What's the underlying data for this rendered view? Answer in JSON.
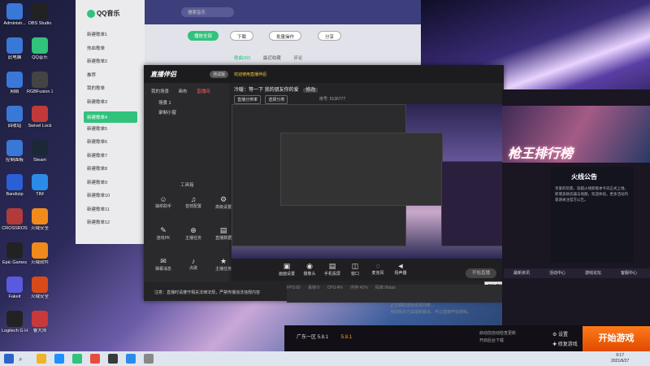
{
  "desktop": {
    "icons": [
      {
        "label": "Administr...",
        "color": "#3a78d8"
      },
      {
        "label": "OBS Studio",
        "color": "#222222"
      },
      {
        "label": "此电脑",
        "color": "#3a78d8"
      },
      {
        "label": "QQ音乐",
        "color": "#31c27c"
      },
      {
        "label": "网络",
        "color": "#3a78d8"
      },
      {
        "label": "RGBFusion 2.0",
        "color": "#444444"
      },
      {
        "label": "回收站",
        "color": "#3a78d8"
      },
      {
        "label": "Swivel Lock",
        "color": "#c03a3a"
      },
      {
        "label": "控制面板",
        "color": "#3a78d8"
      },
      {
        "label": "Steam",
        "color": "#1b2838"
      },
      {
        "label": "Bandizip",
        "color": "#2a5fd8"
      },
      {
        "label": "TIM",
        "color": "#2a8ce8"
      },
      {
        "label": "CROSSROS",
        "color": "#b23a3a"
      },
      {
        "label": "火绒安全",
        "color": "#f08a1a"
      },
      {
        "label": "Epic Games",
        "color": "#222222"
      },
      {
        "label": "火绒软件",
        "color": "#f08a1a"
      },
      {
        "label": "Fakeit",
        "color": "#5a5ae0"
      },
      {
        "label": "火绒安全",
        "color": "#d84a1a"
      },
      {
        "label": "Logitech G HUB",
        "color": "#222222"
      },
      {
        "label": "鲁大师",
        "color": "#c83a3a"
      }
    ]
  },
  "qq_music": {
    "app_name": "QQ音乐",
    "search_placeholder": "搜索音乐",
    "sidebar": [
      "新建歌单1",
      "热血歌单",
      "新建歌单2",
      "推荐",
      "我的歌单",
      "新建歌单3",
      "新建歌单4",
      "新建歌单5",
      "新建歌单6",
      "新建歌单7",
      "新建歌单8",
      "新建歌单9",
      "新建歌单10",
      "新建歌单11",
      "新建歌单12"
    ],
    "buttons": {
      "play_all": "播放全部",
      "download": "下载",
      "batch": "批量操作",
      "share": "分享"
    },
    "tabs": [
      "歌曲200",
      "最近收藏",
      "评论"
    ]
  },
  "live": {
    "app_name": "直播伴侣",
    "badge": "测试版",
    "notice": "欢迎使用直播伴侣",
    "tabs": [
      "我的场景",
      "画布",
      "直播间"
    ],
    "scenes": [
      "场景 1",
      "录制小窗"
    ],
    "tools_header": "工具箱",
    "tools": [
      {
        "icon": "☺",
        "label": "抽奖助手"
      },
      {
        "icon": "♫",
        "label": "音效配置"
      },
      {
        "icon": "⚙",
        "label": "高级设置"
      },
      {
        "icon": "✎",
        "label": "连线PK"
      },
      {
        "icon": "⊕",
        "label": "主播任务"
      },
      {
        "icon": "▤",
        "label": "直播数据"
      },
      {
        "icon": "✉",
        "label": "弹幕消息"
      },
      {
        "icon": "♪",
        "label": "点歌"
      },
      {
        "icon": "★",
        "label": "主播任务"
      }
    ],
    "heading": "冷暖：等一下 我的朋友你的爱",
    "heading_tag": "修改",
    "chips": [
      "直播分辨率",
      "选择分类"
    ],
    "room": "房号: 5136777",
    "controls": [
      {
        "icon": "▣",
        "label": "画面设置"
      },
      {
        "icon": "◉",
        "label": "摄像头"
      },
      {
        "icon": "▤",
        "label": "手机投屏"
      },
      {
        "icon": "◫",
        "label": "窗口"
      },
      {
        "icon": "◌",
        "label": "麦克风"
      },
      {
        "icon": "◄",
        "label": "扬声器"
      }
    ],
    "go_live": "开始直播",
    "tooltip": "开始直播直播",
    "warning": "注意：直播时请遵守相关法律法规，严禁传播违法违规内容",
    "footer": [
      "FPS:60",
      "丢帧:0",
      "CPU:4%",
      "内存:41%",
      "码率:0kbps"
    ]
  },
  "launcher": {
    "banner_title": "枪王排行榜",
    "news_title": "火线公告",
    "news_body": "亲爱的玩家，穿越火线新版本今日正式上线，新增多款武器与地图，欢迎体验。更多活动内容请关注官方公告。",
    "tabs": [
      "最新资讯",
      "活动中心",
      "游戏论坛",
      "客服中心"
    ],
    "server_label": "广东一区",
    "version_label": "5.8.1",
    "version_value": "5.8.1",
    "options": [
      "启动前自动检查更新",
      "开启后台下载"
    ],
    "setting": "设置",
    "repair": "修复游戏",
    "play": "开始游戏",
    "status_lines": [
      "正在获取游戏资源列表...",
      "当前版本已是最新版本，可以直接开始游戏。"
    ]
  },
  "taskbar": {
    "search_icon": "⌕",
    "apps": [
      "#f0b429",
      "#1e90ff",
      "#31c27c",
      "#e84c3d",
      "#3a3a3a",
      "#2a8ce8",
      "#888888"
    ],
    "time": "9:17",
    "date": "2021/6/27"
  }
}
